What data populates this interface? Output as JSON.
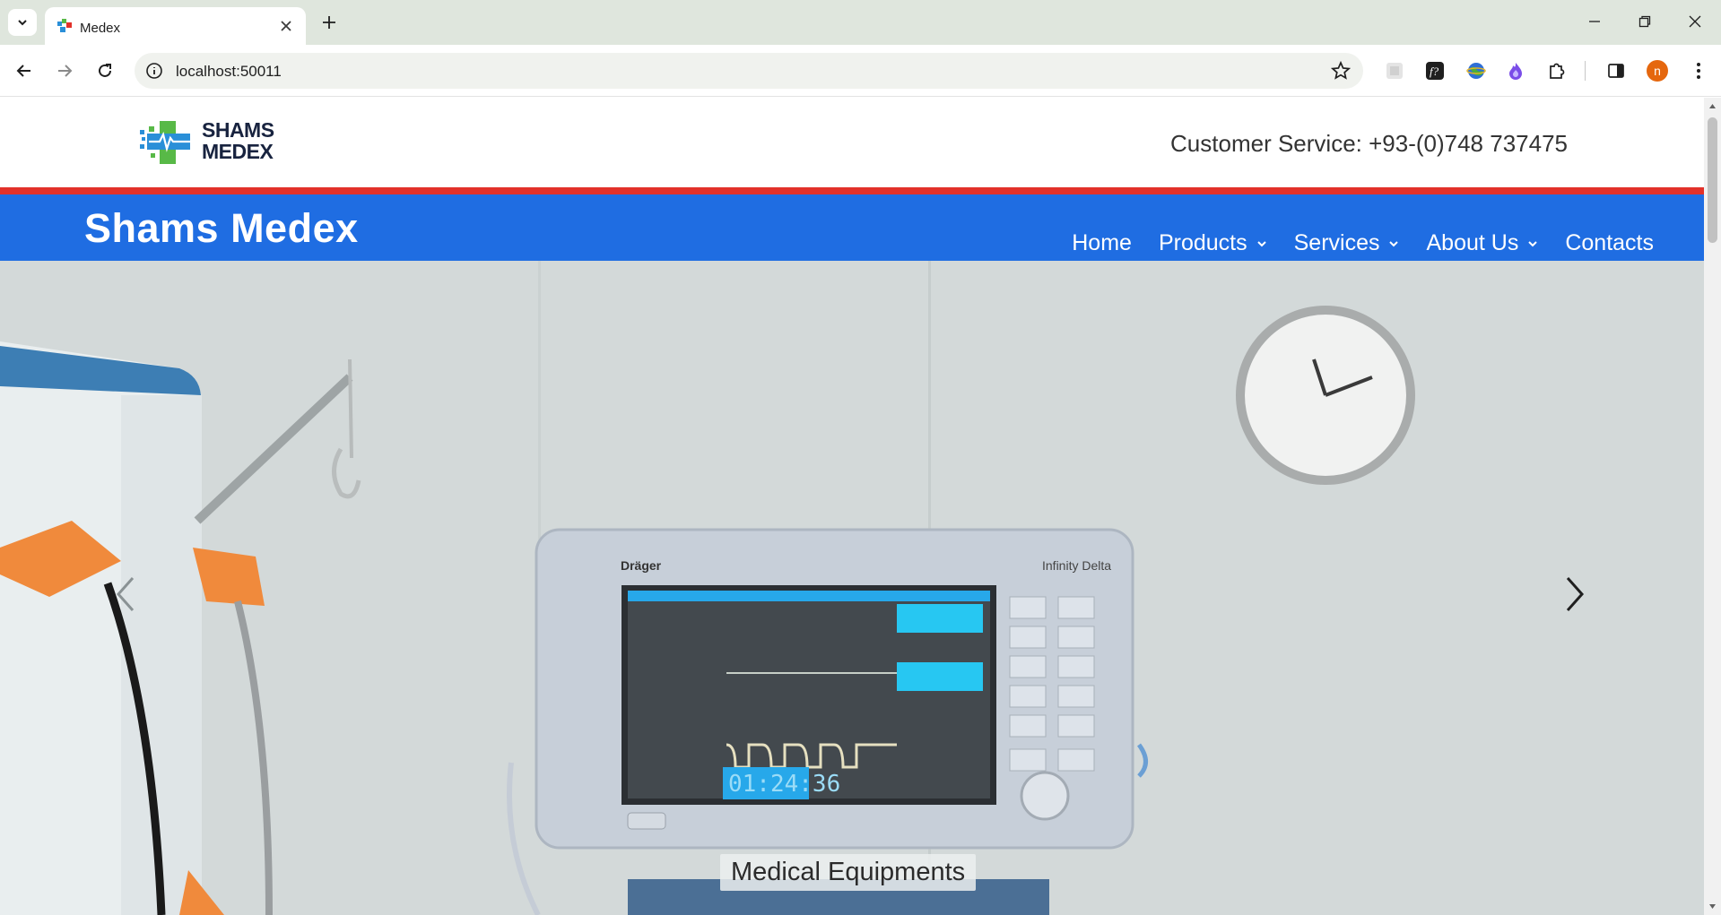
{
  "browser": {
    "tab_title": "Medex",
    "url": "localhost:50011",
    "avatar_letter": "n"
  },
  "site": {
    "customer_service": "Customer Service: +93-(0)748 737475",
    "brand": "Shams Medex",
    "logo_line1": "SHAMS",
    "logo_line2": "MEDEX",
    "nav": {
      "home": "Home",
      "products": "Products",
      "services": "Services",
      "about": "About Us",
      "contacts": "Contacts"
    },
    "hero": {
      "caption": "Medical Equipments",
      "monitor_brand": "Dräger",
      "monitor_model": "Infinity Delta",
      "monitor_time": "01:24:36"
    }
  },
  "colors": {
    "nav_blue": "#1f6de2",
    "stripe_red": "#e2312a",
    "avatar_orange": "#e5670e"
  }
}
